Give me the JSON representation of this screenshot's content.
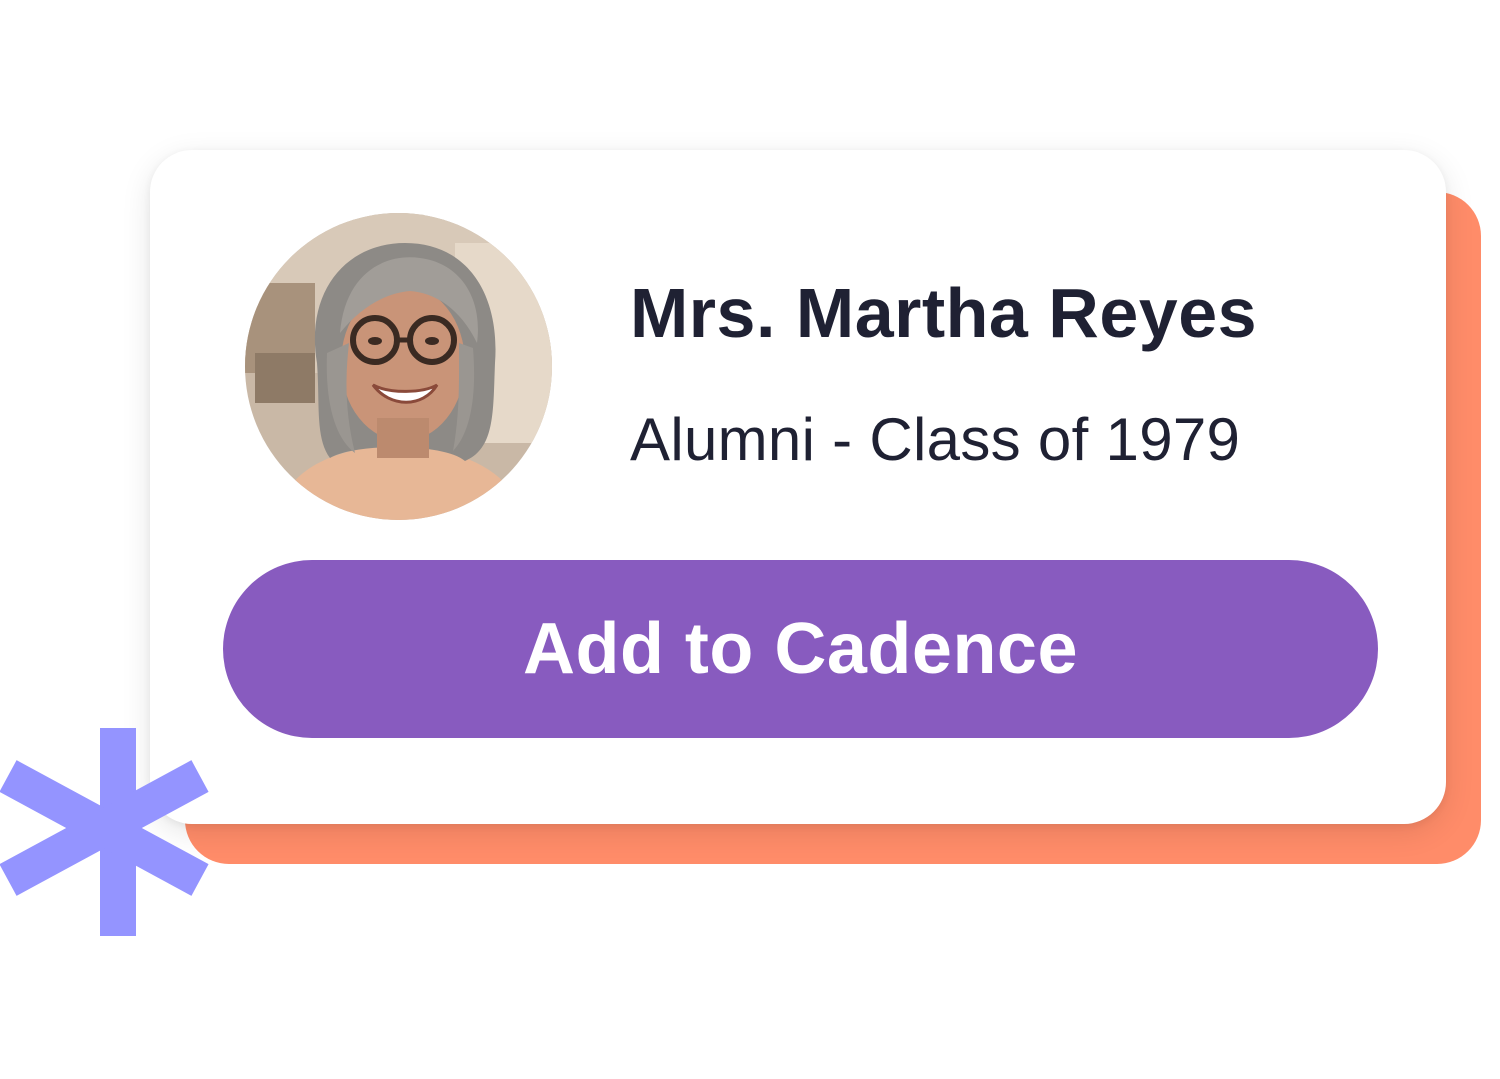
{
  "profile_card": {
    "name": "Mrs. Martha Reyes",
    "subtitle": "Alumni - Class of 1979",
    "avatar_icon": "person-photo",
    "cta_label": "Add to Cadence"
  },
  "colors": {
    "accent_purple": "#885BBF",
    "backdrop_orange": "#FF8C69",
    "asterisk_periwinkle": "#9494FF",
    "text_dark": "#1F2133"
  },
  "decor": {
    "asterisk_icon": "asterisk-icon"
  }
}
